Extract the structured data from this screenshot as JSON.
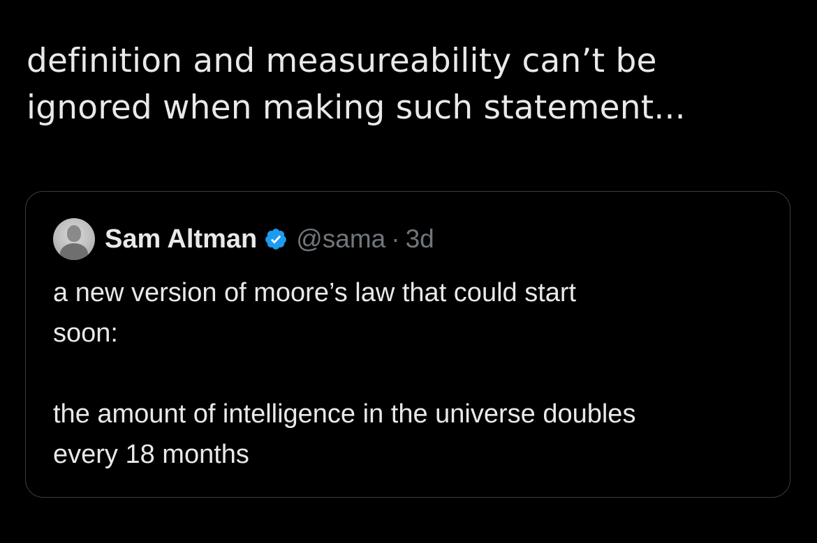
{
  "tweet": {
    "text_lines": [
      "definition and measureability can’t be",
      "ignored when making such statement..."
    ]
  },
  "quoted_tweet": {
    "author_name": "Sam Altman",
    "handle": "@sama",
    "separator": "·",
    "time": "3d",
    "verified_badge_icon": "verified-badge-icon",
    "verified_color": "#1d9bf0",
    "body_lines": [
      "a new version of moore’s law that could start",
      "soon:",
      "",
      "the amount of intelligence in the universe doubles",
      "every 18 months"
    ]
  },
  "colors": {
    "background": "#000000",
    "text": "#e7e9ea",
    "secondary_text": "#71767b",
    "card_border": "#3a3d40"
  }
}
